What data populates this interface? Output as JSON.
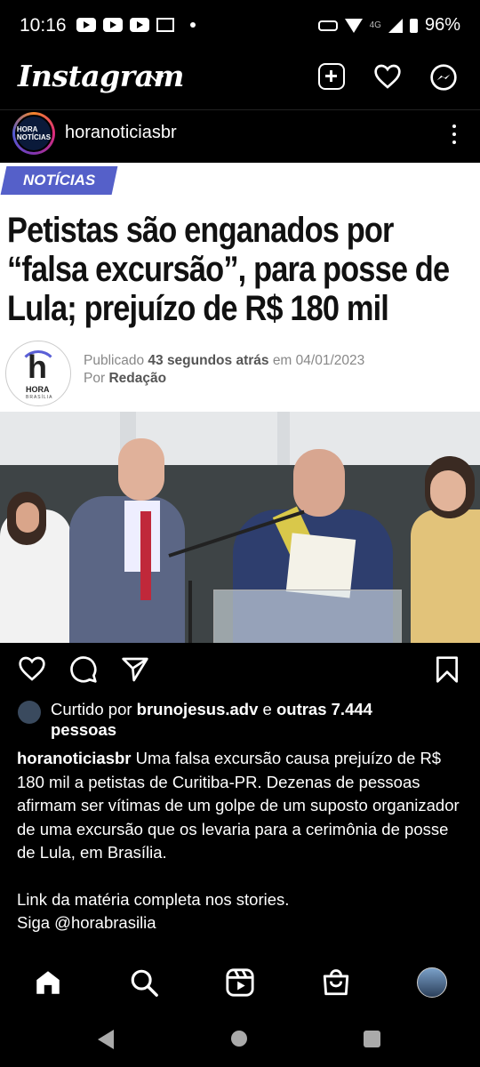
{
  "status_bar": {
    "time": "10:16",
    "network": "4G",
    "battery": "96%"
  },
  "header": {
    "logo": "Instagram",
    "icons": [
      "chevron-down-icon",
      "new-post-icon",
      "heart-icon",
      "messenger-icon"
    ]
  },
  "post": {
    "username": "horanoticiasbr",
    "avatar_text": "HORA NOTÍCIAS",
    "image": {
      "tag": "NOTÍCIAS",
      "headline_lines": [
        "Petistas são enganados por",
        "“falsa excursão”, para posse de",
        "Lula; prejuízo de R$ 180 mil"
      ],
      "logo_letter": "h",
      "logo_name": "HORA",
      "logo_sub": "BRASÍLIA",
      "published_prefix": "Publicado",
      "published_time": "43 segundos atrás",
      "published_mid": "em 04/01/2023",
      "by_prefix": "Por",
      "author": "Redação"
    },
    "likes": {
      "prefix": "Curtido por",
      "user": "brunojesus.adv",
      "and": "e",
      "others": "outras 7.444",
      "suffix": "pessoas"
    },
    "caption": {
      "username": "horanoticiasbr",
      "text": "Uma falsa excursão causa prejuízo de R$ 180 mil a petistas de Curitiba-PR. Dezenas de pessoas afirmam ser vítimas de um golpe de um suposto organizador de uma excursão que os levaria para a cerimônia de posse de Lula, em Brasília.",
      "line2": "Link da matéria completa nos stories.",
      "line3": "Siga @horabrasilia"
    }
  },
  "bottom_nav": [
    "home-icon",
    "search-icon",
    "reels-icon",
    "shop-icon",
    "profile-avatar"
  ],
  "colors": {
    "tag": "#5560c9",
    "background": "#000000"
  }
}
